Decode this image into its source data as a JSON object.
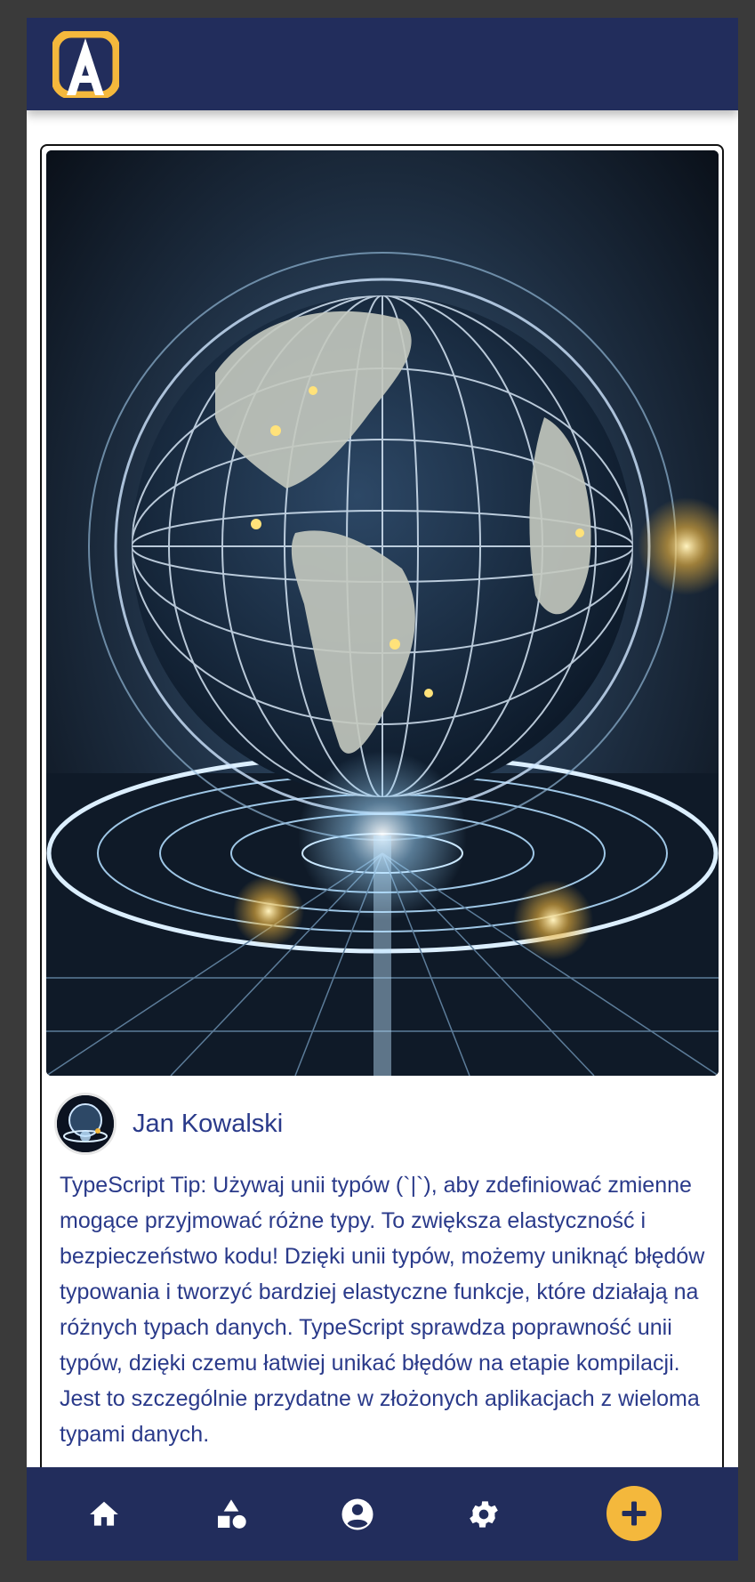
{
  "header": {
    "logo_icon": "app-logo-icon",
    "brand_color": "#222d5c",
    "accent_color": "#f4b83c"
  },
  "post": {
    "image_icon": "globe-hologram-image",
    "author": {
      "name": "Jan Kowalski",
      "avatar_icon": "avatar-globe-icon"
    },
    "text": "TypeScript Tip: Używaj unii typów (`|`), aby zdefiniować zmienne mogące przyjmować różne typy. To zwiększa elastyczność i bezpieczeństwo kodu! Dzięki unii typów, możemy uniknąć błędów typowania i tworzyć bardziej elastyczne funkcje, które działają na różnych typach danych. TypeScript sprawdza poprawność unii typów, dzięki czemu łatwiej unikać błędów na etapie kompilacji. Jest to szczególnie przydatne w złożonych aplikacjach z wieloma typami danych."
  },
  "nav": {
    "items": [
      {
        "icon": "home-icon"
      },
      {
        "icon": "shapes-icon"
      },
      {
        "icon": "profile-icon"
      },
      {
        "icon": "settings-icon"
      },
      {
        "icon": "plus-icon"
      }
    ]
  }
}
